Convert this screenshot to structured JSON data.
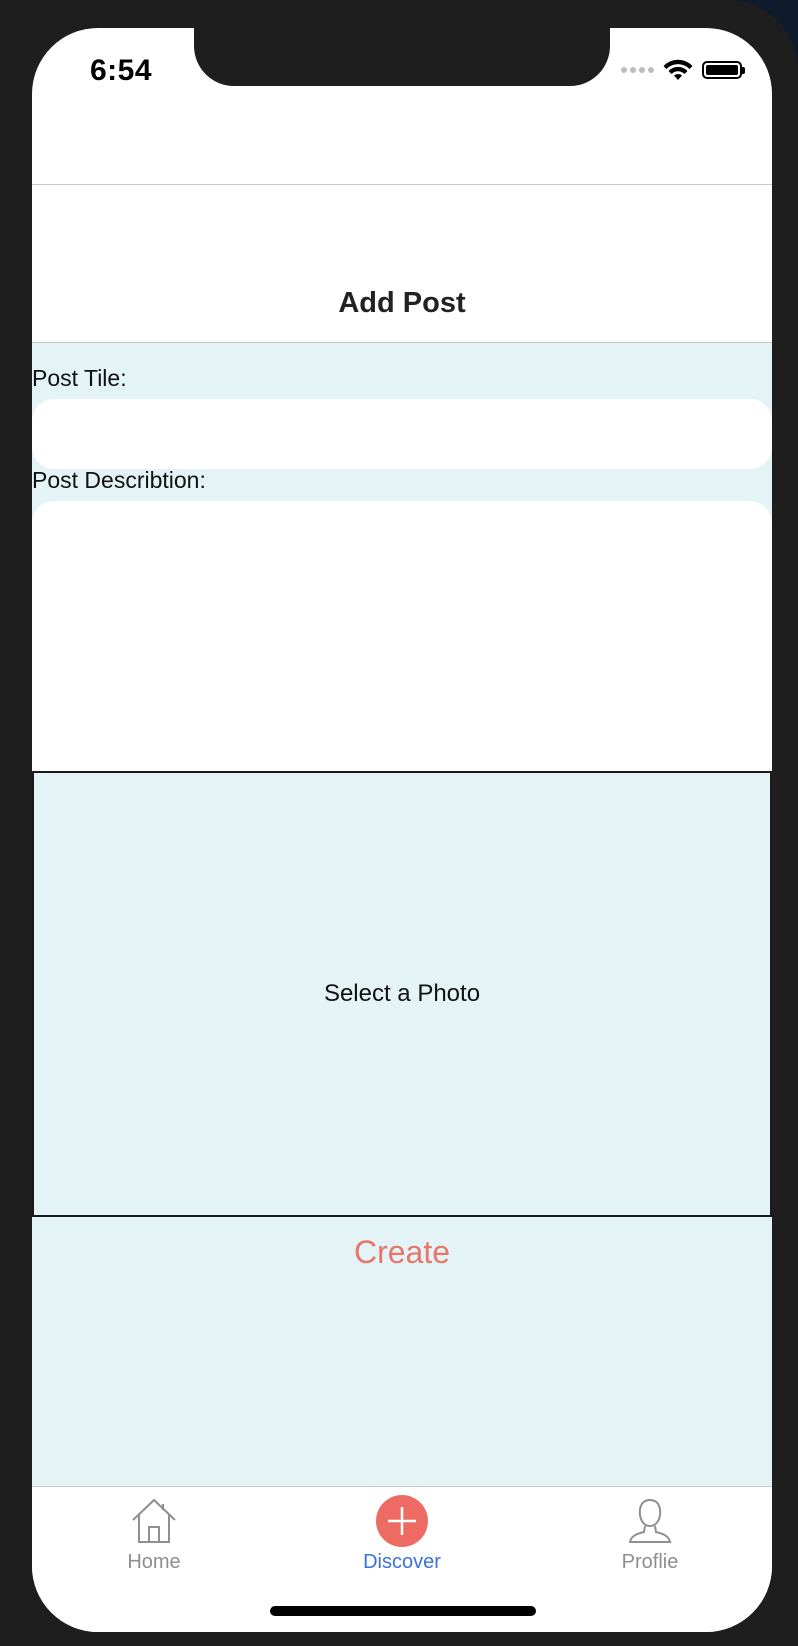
{
  "status_bar": {
    "time": "6:54"
  },
  "header": {
    "title": "Add Post"
  },
  "form": {
    "title_label": "Post Tile:",
    "title_value": "",
    "description_label": "Post Describtion:",
    "description_value": "",
    "photo_label": "Select a Photo",
    "create_label": "Create"
  },
  "tabbar": {
    "tabs": [
      {
        "label": "Home",
        "icon": "home-icon",
        "active": false
      },
      {
        "label": "Discover",
        "icon": "plus-circle-icon",
        "active": true
      },
      {
        "label": "Proflie",
        "icon": "user-icon",
        "active": false
      }
    ],
    "active_color": "#3a73d8",
    "inactive_color": "#8e8e93"
  },
  "colors": {
    "content_background": "#e4f3f6",
    "create_text": "#e8766c",
    "discover_icon": "#ee6b63"
  }
}
